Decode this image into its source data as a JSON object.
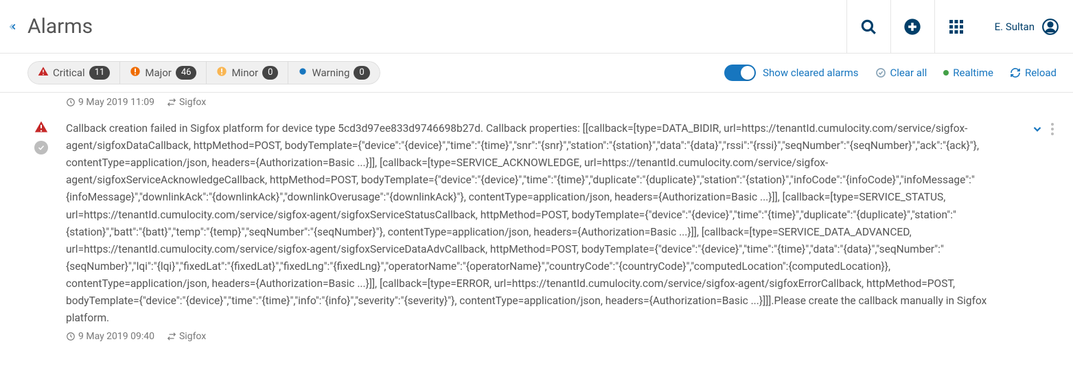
{
  "header": {
    "title": "Alarms",
    "user_name": "E. Sultan"
  },
  "toolbar": {
    "sev": {
      "critical": {
        "label": "Critical",
        "count": "11"
      },
      "major": {
        "label": "Major",
        "count": "46"
      },
      "minor": {
        "label": "Minor",
        "count": "0"
      },
      "warning": {
        "label": "Warning",
        "count": "0"
      }
    },
    "switch_label": "Show cleared alarms",
    "clear_all": "Clear all",
    "realtime": "Realtime",
    "reload": "Reload"
  },
  "alarms": {
    "a0": {
      "timestamp": "9 May 2019 11:09",
      "source": "Sigfox"
    },
    "a1": {
      "text": "Callback creation failed in Sigfox platform for device type 5cd3d97ee833d9746698b27d. Callback properties: [[callback=[type=DATA_BIDIR, url=https://tenantId.cumulocity.com/service/sigfox-agent/sigfoxDataCallback, httpMethod=POST, bodyTemplate={\"device\":\"{device}\",\"time\":\"{time}\",\"snr\":\"{snr}\",\"station\":\"{station}\",\"data\":\"{data}\",\"rssi\":\"{rssi}\",\"seqNumber\":\"{seqNumber}\",\"ack\":\"{ack}\"}, contentType=application/json, headers={Authorization=Basic ...}]], [callback=[type=SERVICE_ACKNOWLEDGE, url=https://tenantId.cumulocity.com/service/sigfox-agent/sigfoxServiceAcknowledgeCallback, httpMethod=POST, bodyTemplate={\"device\":\"{device}\",\"time\":\"{time}\",\"duplicate\":\"{duplicate}\",\"station\":\"{station}\",\"infoCode\":\"{infoCode}\",\"infoMessage\":\"{infoMessage}\",\"downlinkAck\":\"{downlinkAck}\",\"downlinkOverusage\":\"{downlinkAck}\"}, contentType=application/json, headers={Authorization=Basic ...}]], [callback=[type=SERVICE_STATUS, url=https://tenantId.cumulocity.com/service/sigfox-agent/sigfoxServiceStatusCallback, httpMethod=POST, bodyTemplate={\"device\":\"{device}\",\"time\":\"{time}\",\"duplicate\":\"{duplicate}\",\"station\":\"{station}\",\"batt\":\"{batt}\",\"temp\":\"{temp}\",\"seqNumber\":\"{seqNumber}\"}, contentType=application/json, headers={Authorization=Basic ...}]], [callback=[type=SERVICE_DATA_ADVANCED, url=https://tenantId.cumulocity.com/service/sigfox-agent/sigfoxServiceDataAdvCallback, httpMethod=POST, bodyTemplate={\"device\":\"{device}\",\"time\":\"{time}\",\"data\":\"{data}\",\"seqNumber\":\"{seqNumber}\",\"lqi\":\"{lqi}\",\"fixedLat\":\"{fixedLat}\",\"fixedLng\":\"{fixedLng}\",\"operatorName\":\"{operatorName}\",\"countryCode\":\"{countryCode}\",\"computedLocation\":{computedLocation}}, contentType=application/json, headers={Authorization=Basic ...}]], [callback=[type=ERROR, url=https://tenantId.cumulocity.com/service/sigfox-agent/sigfoxErrorCallback, httpMethod=POST, bodyTemplate={\"device\":\"{device}\",\"time\":\"{time}\",\"info\":\"{info}\",\"severity\":\"{severity}\"}, contentType=application/json, headers={Authorization=Basic ...}]]].Please create the callback manually in Sigfox platform.",
      "timestamp": "9 May 2019 09:40",
      "source": "Sigfox"
    }
  }
}
